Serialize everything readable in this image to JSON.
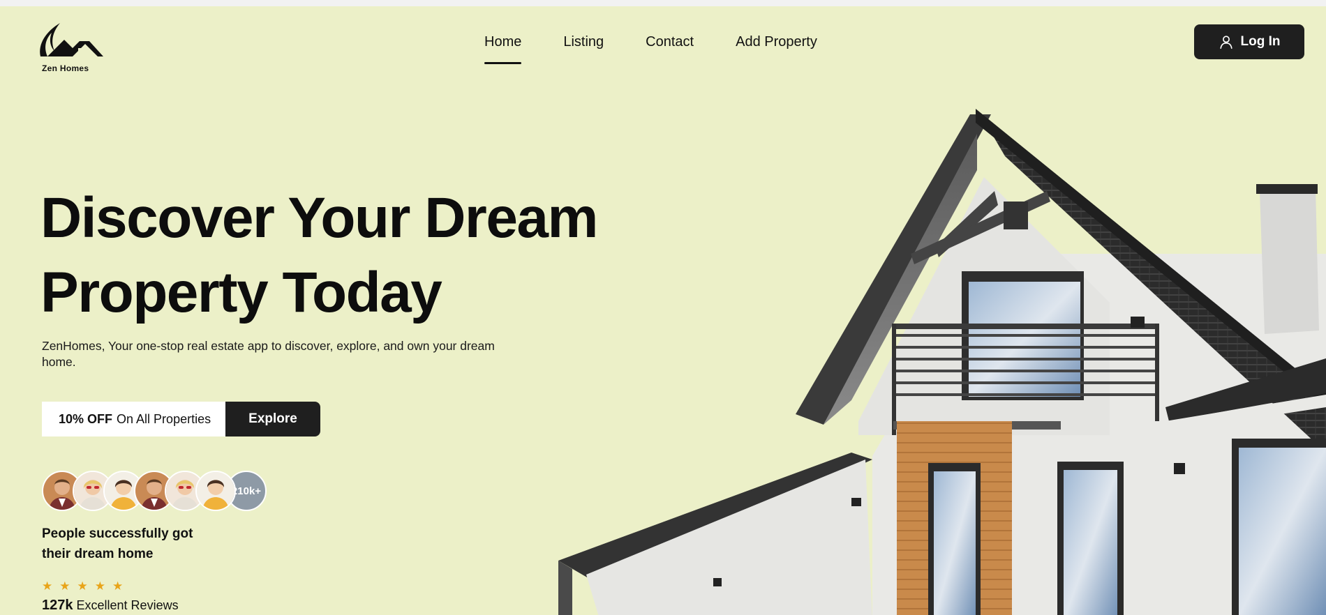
{
  "brand": {
    "name": "Zen Homes"
  },
  "nav": {
    "items": [
      {
        "label": "Home",
        "active": true
      },
      {
        "label": "Listing",
        "active": false
      },
      {
        "label": "Contact",
        "active": false
      },
      {
        "label": "Add Property",
        "active": false
      }
    ]
  },
  "header": {
    "login_label": "Log In",
    "login_icon": "user-icon"
  },
  "hero": {
    "title_line1": "Discover Your Dream",
    "title_line2": "Property Today",
    "subtitle": "ZenHomes, Your one-stop real estate app to discover, explore, and own your dream home.",
    "offer_bold": "10% OFF",
    "offer_rest": "On All Properties",
    "explore_label": "Explore"
  },
  "social_proof": {
    "avatar_count_label": "210k+",
    "people_text_line1": "People successfully got",
    "people_text_line2": "their dream home",
    "rating_stars": 5,
    "reviews_count": "127k",
    "reviews_label": "Excellent Reviews"
  },
  "colors": {
    "background": "#ecf0c8",
    "dark_button": "#1f1f1f",
    "star": "#e8a419",
    "avatar_count_bg": "#8e9aa6"
  }
}
